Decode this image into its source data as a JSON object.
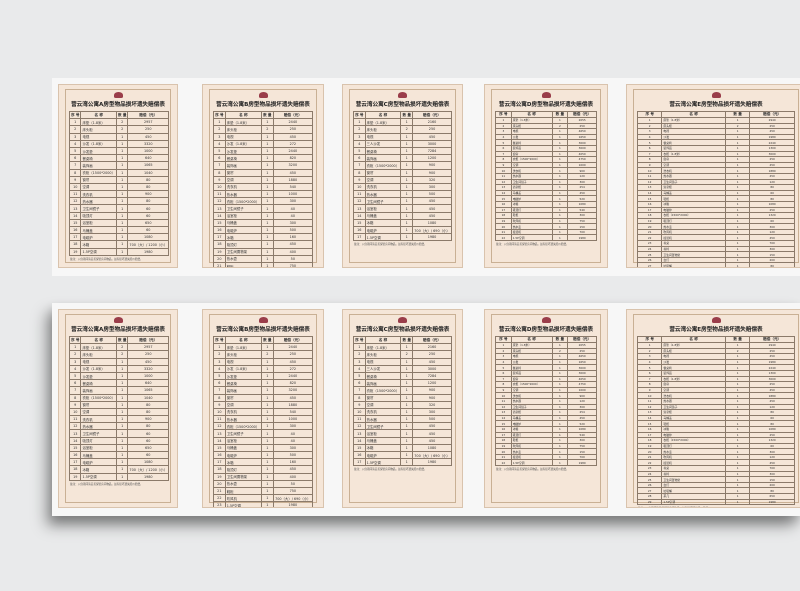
{
  "cards": [
    {
      "title": "营云湾公寓A房型物品损坏遗失赔偿表",
      "headers": [
        "序 号",
        "名  称",
        "数 量",
        "赔偿（元）"
      ],
      "rows": [
        [
          "1",
          "床垫（1.8米）",
          "2",
          "2957"
        ],
        [
          "2",
          "床头柜",
          "2",
          "250"
        ],
        [
          "3",
          "电视",
          "1",
          "450"
        ],
        [
          "4",
          "沙发（1.8米）",
          "1",
          "3320"
        ],
        [
          "5",
          "沙发垫",
          "1",
          "1000"
        ],
        [
          "6",
          "餐桌椅",
          "1",
          "640"
        ],
        [
          "7",
          "装饰画",
          "1",
          "1065"
        ],
        [
          "8",
          "衣柜（1500*2000）",
          "1",
          "1040"
        ],
        [
          "9",
          "窗帘",
          "1",
          "80"
        ],
        [
          "10",
          "空调",
          "1",
          "80"
        ],
        [
          "11",
          "洗衣机",
          "1",
          "900"
        ],
        [
          "12",
          "热水器",
          "1",
          "80"
        ],
        [
          "13",
          "卫生间镜子",
          "1",
          "60"
        ],
        [
          "14",
          "吸顶灯",
          "1",
          "60"
        ],
        [
          "15",
          "浴室柜",
          "1",
          "650"
        ],
        [
          "16",
          "马桶盖",
          "1",
          "60"
        ],
        [
          "17",
          "电磁炉",
          "1",
          "1080"
        ],
        [
          "18",
          "冰箱",
          "1",
          "700（大）/ 1200（小）"
        ],
        [
          "19",
          "1.5P空调",
          "1",
          "1980"
        ]
      ],
      "notes": "备注：入住期间请妥善保管房间物品，如有损坏遗失照价赔偿。"
    },
    {
      "title": "营云湾公寓B房型物品损坏遗失赔偿表",
      "headers": [
        "序 号",
        "名  称",
        "数 量",
        "赔偿（元）"
      ],
      "rows": [
        [
          "1",
          "床垫（1.8米）",
          "1",
          "2440"
        ],
        [
          "2",
          "床头柜",
          "2",
          "250"
        ],
        [
          "3",
          "电视",
          "1",
          "450"
        ],
        [
          "4",
          "沙发（1.8米）",
          "1",
          "272"
        ],
        [
          "5",
          "沙发垫",
          "1",
          "2440"
        ],
        [
          "6",
          "餐桌椅",
          "1",
          "820"
        ],
        [
          "7",
          "装饰画",
          "1",
          "3200"
        ],
        [
          "8",
          "窗帘",
          "1",
          "450"
        ],
        [
          "9",
          "空调",
          "1",
          "1880"
        ],
        [
          "10",
          "洗衣机",
          "1",
          "540"
        ],
        [
          "11",
          "热水器",
          "1",
          "1000"
        ],
        [
          "12",
          "衣柜（1500*2000）",
          "1",
          "300"
        ],
        [
          "13",
          "卫生间镜子",
          "1",
          "40"
        ],
        [
          "14",
          "浴室柜",
          "1",
          "40"
        ],
        [
          "15",
          "马桶盖",
          "1",
          "300"
        ],
        [
          "16",
          "电磁炉",
          "1",
          "500"
        ],
        [
          "17",
          "冰箱",
          "1",
          "160"
        ],
        [
          "18",
          "吸顶灯",
          "1",
          "450"
        ],
        [
          "19",
          "卫生间置物架",
          "1",
          "400"
        ],
        [
          "20",
          "热水壶",
          "1",
          "50"
        ],
        [
          "21",
          "鞋柜",
          "1",
          "750"
        ],
        [
          "22",
          "吹风机",
          "1",
          "700（大）/ 690（小）"
        ],
        [
          "23",
          "1.5P空调",
          "1",
          "1980"
        ]
      ],
      "notes": "备注：入住期间请妥善保管房间物品，如有损坏遗失照价赔偿。"
    },
    {
      "title": "营云湾公寓C房型物品损坏遗失赔偿表",
      "headers": [
        "序 号",
        "名  称",
        "数 量",
        "赔偿（元）"
      ],
      "rows": [
        [
          "1",
          "床垫（1.8米）",
          "1",
          "2160"
        ],
        [
          "2",
          "床头柜",
          "2",
          "250"
        ],
        [
          "3",
          "电视",
          "1",
          "450"
        ],
        [
          "4",
          "三人沙发",
          "1",
          "3000"
        ],
        [
          "5",
          "餐桌椅",
          "1",
          "7284"
        ],
        [
          "6",
          "装饰画",
          "1",
          "1200"
        ],
        [
          "7",
          "衣柜（1500*2000）",
          "1",
          "900"
        ],
        [
          "8",
          "窗帘",
          "1",
          "900"
        ],
        [
          "9",
          "空调",
          "1",
          "320"
        ],
        [
          "10",
          "洗衣机",
          "1",
          "300"
        ],
        [
          "11",
          "热水器",
          "1",
          "500"
        ],
        [
          "12",
          "卫生间镜子",
          "1",
          "450"
        ],
        [
          "13",
          "浴室柜",
          "1",
          "450"
        ],
        [
          "14",
          "马桶盖",
          "1",
          "450"
        ],
        [
          "15",
          "冰箱",
          "1",
          "1080"
        ],
        [
          "16",
          "电磁炉",
          "1",
          "700（大）/ 690（小）"
        ],
        [
          "17",
          "1.5P空调",
          "1",
          "1980"
        ]
      ],
      "notes": "备注：入住期间请妥善保管房间物品，如有损坏遗失照价赔偿。"
    },
    {
      "title": "营云湾公寓D房型物品损坏遗失赔偿表",
      "headers": [
        "序 号",
        "名  称",
        "数 量",
        "赔偿（元）"
      ],
      "rows": [
        [
          "1",
          "床垫（1.8米）",
          "1",
          "2055"
        ],
        [
          "2",
          "床头柜",
          "2",
          "250"
        ],
        [
          "3",
          "电视",
          "1",
          "4650"
        ],
        [
          "4",
          "沙发",
          "1",
          "1650"
        ],
        [
          "5",
          "餐桌椅",
          "1",
          "3000"
        ],
        [
          "6",
          "装饰画",
          "1",
          "3000"
        ],
        [
          "7",
          "窗帘",
          "1",
          "4050"
        ],
        [
          "8",
          "衣柜（1500*2000）",
          "1",
          "4750"
        ],
        [
          "9",
          "空调",
          "1",
          "1000"
        ],
        [
          "10",
          "洗衣机",
          "1",
          "900"
        ],
        [
          "11",
          "热水器",
          "1",
          "120"
        ],
        [
          "12",
          "卫生间镜子",
          "1",
          "300"
        ],
        [
          "13",
          "浴室柜",
          "1",
          "254"
        ],
        [
          "14",
          "马桶盖",
          "1",
          "450"
        ],
        [
          "15",
          "电磁炉",
          "1",
          "520"
        ],
        [
          "16",
          "冰箱",
          "1",
          "1080"
        ],
        [
          "17",
          "吸顶灯",
          "1",
          "540"
        ],
        [
          "18",
          "鞋柜",
          "1",
          "300"
        ],
        [
          "19",
          "吹风机",
          "1",
          "750"
        ],
        [
          "20",
          "热水壶",
          "1",
          "150"
        ],
        [
          "21",
          "挂烫机",
          "1",
          "700"
        ],
        [
          "22",
          "1.5P空调",
          "1",
          "1980"
        ]
      ],
      "notes": "备注：入住期间请妥善保管房间物品，如有损坏遗失照价赔偿。"
    },
    {
      "title": "营云湾公寓E房型物品损坏遗失赔偿表",
      "headers": [
        "序 号",
        "名  称",
        "数 量",
        "赔偿（元）"
      ],
      "rows": [
        [
          "1",
          "床垫（1.8米）",
          "1",
          "2940"
        ],
        [
          "2",
          "床头柜",
          "2",
          "250"
        ],
        [
          "3",
          "电视",
          "1",
          "450"
        ],
        [
          "4",
          "沙发",
          "1",
          "1980"
        ],
        [
          "5",
          "餐桌椅",
          "1",
          "2240"
        ],
        [
          "6",
          "装饰画",
          "1",
          "1300"
        ],
        [
          "7",
          "衣柜（1.8米）",
          "1",
          "3000"
        ],
        [
          "8",
          "窗帘",
          "1",
          "250"
        ],
        [
          "9",
          "空调",
          "1",
          "450"
        ],
        [
          "10",
          "洗衣机",
          "1",
          "1880"
        ],
        [
          "11",
          "热水器",
          "1",
          "450"
        ],
        [
          "12",
          "卫生间镜子",
          "1",
          "120"
        ],
        [
          "13",
          "浴室柜",
          "1",
          "80"
        ],
        [
          "14",
          "马桶盖",
          "1",
          "60"
        ],
        [
          "15",
          "鞋柜",
          "1",
          "80"
        ],
        [
          "16",
          "冰箱",
          "1",
          "1080"
        ],
        [
          "17",
          "电磁炉",
          "1",
          "250"
        ],
        [
          "18",
          "衣柜（1500*2000）",
          "1",
          "1320"
        ],
        [
          "19",
          "吸顶灯",
          "1",
          "60"
        ],
        [
          "20",
          "热水壶",
          "1",
          "300"
        ],
        [
          "21",
          "吹风机",
          "1",
          "120"
        ],
        [
          "22",
          "挂烫机",
          "1",
          "450"
        ],
        [
          "23",
          "书桌",
          "1",
          "700"
        ],
        [
          "24",
          "书椅",
          "1",
          "300"
        ],
        [
          "25",
          "卫生间置物架",
          "1",
          "150"
        ],
        [
          "26",
          "台灯",
          "1",
          "200"
        ],
        [
          "27",
          "垃圾桶",
          "1",
          "80"
        ],
        [
          "28",
          "茶几",
          "1",
          "650"
        ],
        [
          "29",
          "1.5P空调",
          "1",
          "1980"
        ]
      ],
      "notes": "备注：入住期间请妥善保管房间物品，如有损坏遗失照价赔偿。"
    }
  ]
}
